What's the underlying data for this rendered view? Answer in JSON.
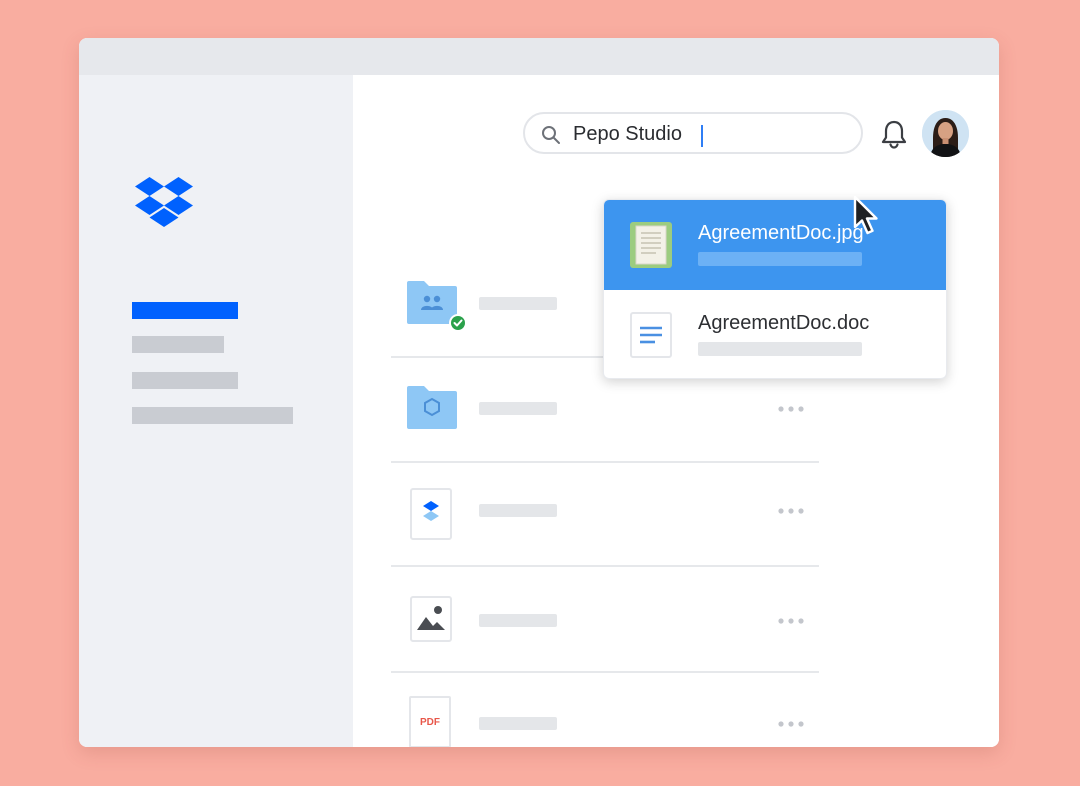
{
  "search": {
    "value": "Pepo Studio",
    "icon": "search-icon"
  },
  "header": {
    "notifications_icon": "bell-icon",
    "avatar_icon": "user-avatar"
  },
  "dropdown": {
    "results": [
      {
        "name": "AgreementDoc.jpg",
        "icon": "image-file-icon",
        "selected": true
      },
      {
        "name": "AgreementDoc.doc",
        "icon": "document-file-icon",
        "selected": false
      }
    ]
  },
  "files": [
    {
      "icon": "shared-folder-icon",
      "synced": true
    },
    {
      "icon": "team-folder-icon",
      "synced": false
    },
    {
      "icon": "dropbox-file-icon",
      "synced": false
    },
    {
      "icon": "image-file-icon",
      "synced": false
    },
    {
      "icon": "pdf-file-icon",
      "label": "PDF",
      "synced": false
    }
  ],
  "colors": {
    "background": "#f9ada0",
    "brand_blue": "#0061fe",
    "selection_blue": "#3d95ef",
    "sidebar": "#eff1f5",
    "sync_green": "#2aa14b",
    "pdf_red": "#e8574a"
  }
}
